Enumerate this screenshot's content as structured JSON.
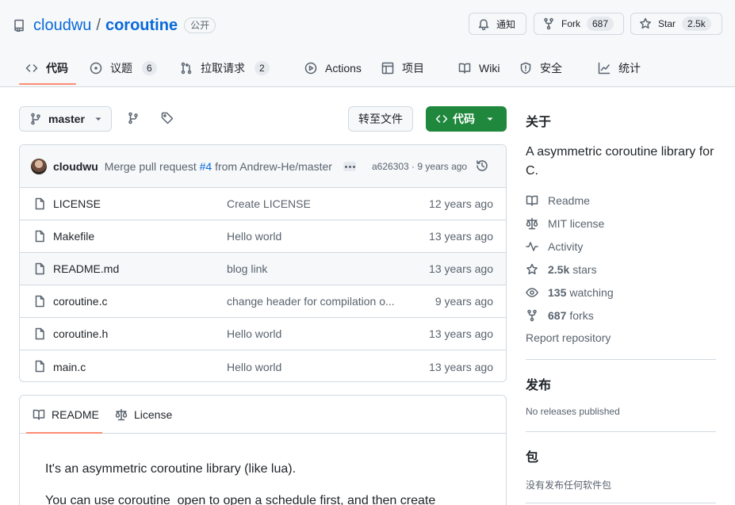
{
  "repo": {
    "owner": "cloudwu",
    "separator": "/",
    "name": "coroutine",
    "visibility": "公开"
  },
  "header_actions": {
    "notify_label": "通知",
    "fork_label": "Fork",
    "fork_count": "687",
    "star_label": "Star",
    "star_count": "2.5k"
  },
  "tabs": [
    {
      "label": "代码",
      "icon": "code-icon"
    },
    {
      "label": "议题",
      "icon": "issue-icon",
      "count": "6"
    },
    {
      "label": "拉取请求",
      "icon": "pull-request-icon",
      "count": "2"
    },
    {
      "label": "Actions",
      "icon": "play-icon"
    },
    {
      "label": "项目",
      "icon": "table-icon"
    },
    {
      "label": "Wiki",
      "icon": "book-icon"
    },
    {
      "label": "安全",
      "icon": "shield-icon"
    },
    {
      "label": "统计",
      "icon": "graph-icon"
    }
  ],
  "branch": {
    "name": "master",
    "goto_file_label": "转至文件",
    "code_button_label": "代码"
  },
  "latest_commit": {
    "author": "cloudwu",
    "message_prefix": "Merge pull request ",
    "pr_link": "#4",
    "message_suffix": " from Andrew-He/master",
    "sha_time": "a626303 · 9 years ago"
  },
  "files": [
    {
      "name": "LICENSE",
      "message": "Create LICENSE",
      "age": "12 years ago"
    },
    {
      "name": "Makefile",
      "message": "Hello world",
      "age": "13 years ago"
    },
    {
      "name": "README.md",
      "message": "blog link",
      "age": "13 years ago"
    },
    {
      "name": "coroutine.c",
      "message": "change header for compilation o...",
      "age": "9 years ago"
    },
    {
      "name": "coroutine.h",
      "message": "Hello world",
      "age": "13 years ago"
    },
    {
      "name": "main.c",
      "message": "Hello world",
      "age": "13 years ago"
    }
  ],
  "readme": {
    "tab_readme": "README",
    "tab_license": "License",
    "paragraph_1": "It's an asymmetric coroutine library (like lua).",
    "paragraph_2": "You can use coroutine_open to open a schedule first, and then create"
  },
  "about": {
    "heading": "关于",
    "description": "A asymmetric coroutine library for C.",
    "readme_link": "Readme",
    "license_link": "MIT license",
    "activity_link": "Activity",
    "stars_count": "2.5k",
    "stars_label": "stars",
    "watching_count": "135",
    "watching_label": "watching",
    "forks_count": "687",
    "forks_label": "forks",
    "report_link": "Report repository"
  },
  "releases": {
    "heading": "发布",
    "empty_text": "No releases published"
  },
  "packages": {
    "heading": "包",
    "empty_text": "没有发布任何软件包"
  },
  "colors": {
    "link_blue": "#0969da",
    "code_button_green": "#1f883d",
    "tab_underline": "#fd8c73",
    "border": "#d1d9e0"
  }
}
